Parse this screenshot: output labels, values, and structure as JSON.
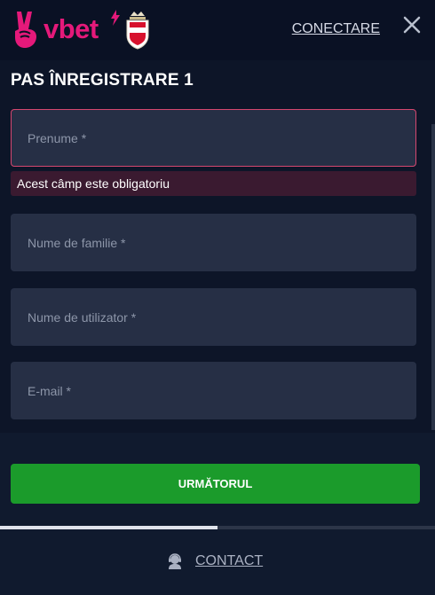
{
  "header": {
    "logo_text": "vbet",
    "login_label": "CONECTARE"
  },
  "form": {
    "step_title": "PAS ÎNREGISTRARE 1",
    "fields": [
      {
        "placeholder": "Prenume *",
        "error": "Acest câmp este obligatoriu"
      },
      {
        "placeholder": "Nume de familie *"
      },
      {
        "placeholder": "Nume de utilizator *"
      },
      {
        "placeholder": "E-mail *"
      }
    ],
    "next_label": "URMĂTORUL"
  },
  "progress": {
    "fraction": 0.5
  },
  "footer": {
    "contact_label": "CONTACT"
  },
  "colors": {
    "brand": "#e5197a",
    "background": "#0d1528",
    "field": "#262f45",
    "error_border": "#d6476f",
    "error_bg": "#3a1a30",
    "primary_button": "#1b9b2b"
  },
  "icons": {
    "logo": "victory-hand-icon",
    "close": "close-icon",
    "contact": "support-agent-icon"
  }
}
